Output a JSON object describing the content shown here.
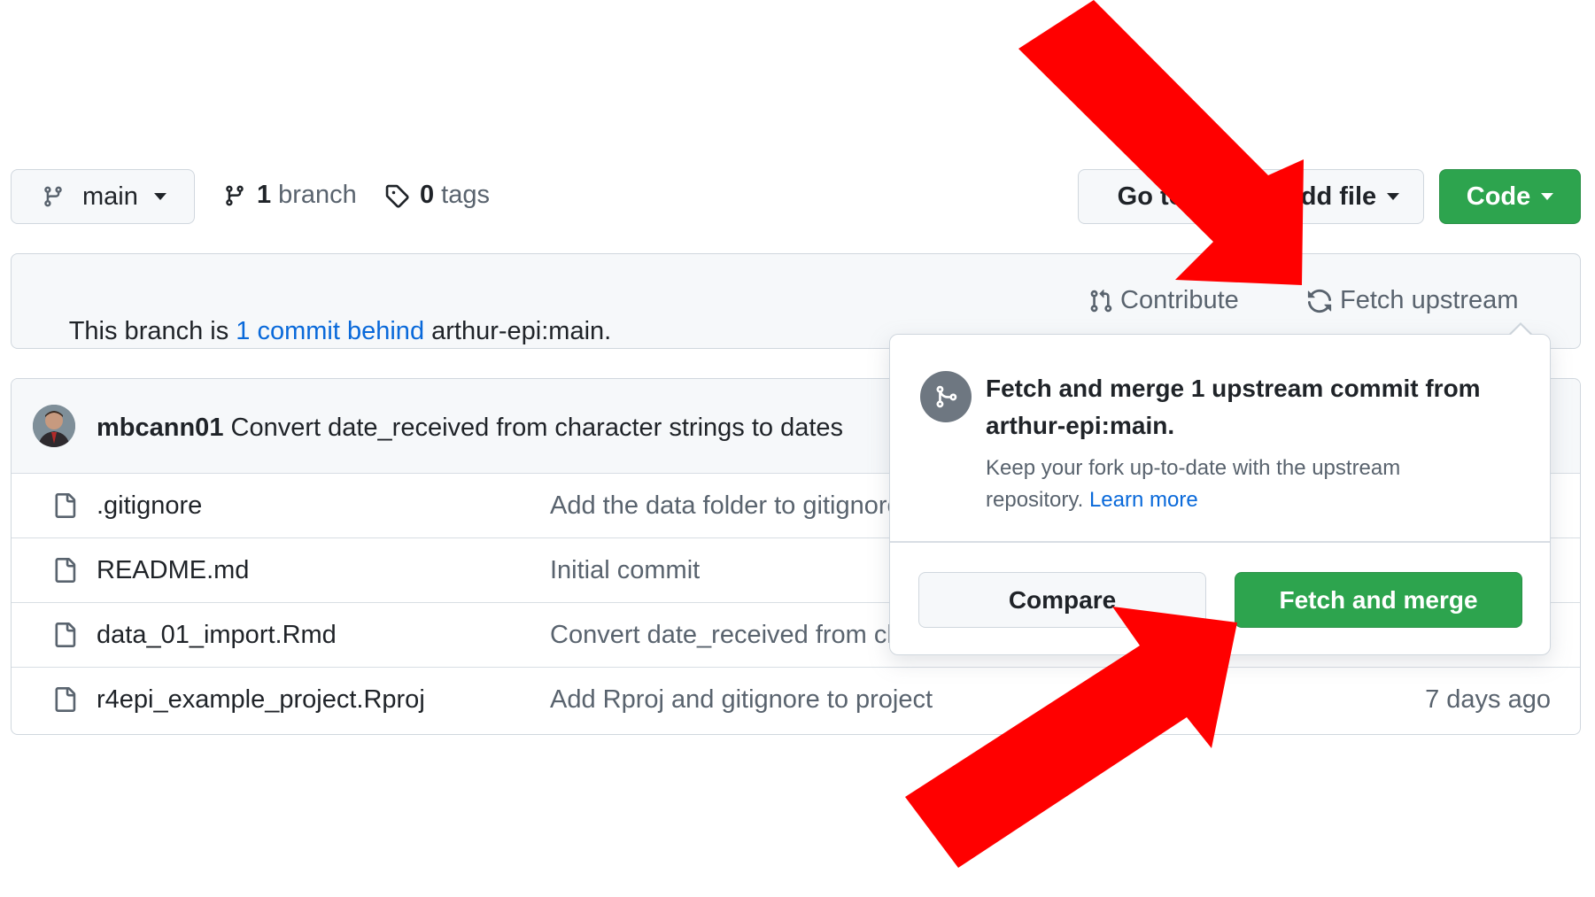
{
  "toolbar": {
    "branch_select_label": "main",
    "branches_count": "1",
    "branches_label": "branch",
    "tags_count": "0",
    "tags_label": "tags",
    "goto_file_label": "Go to file",
    "add_file_label": "Add file",
    "code_label": "Code"
  },
  "status_bar": {
    "text_prefix": "This branch is ",
    "behind_link": "1 commit behind",
    "text_suffix": " arthur-epi:main.",
    "contribute_label": "Contribute",
    "fetch_upstream_label": "Fetch upstream"
  },
  "latest_commit": {
    "author": "mbcann01",
    "message": "Convert date_received from character strings to dates"
  },
  "files": [
    {
      "name": ".gitignore",
      "message": "Add the data folder to gitignore",
      "date": ""
    },
    {
      "name": "README.md",
      "message": "Initial commit",
      "date": ""
    },
    {
      "name": "data_01_import.Rmd",
      "message": "Convert date_received from character strings to dates",
      "date": ""
    },
    {
      "name": "r4epi_example_project.Rproj",
      "message": "Add Rproj and gitignore to project",
      "date": "7 days ago"
    }
  ],
  "fetch_popup": {
    "title": "Fetch and merge 1 upstream commit from arthur-epi:main.",
    "description": "Keep your fork up-to-date with the upstream repository.",
    "learn_more": "Learn more",
    "compare_label": "Compare",
    "fetch_merge_label": "Fetch and merge"
  },
  "colors": {
    "green_button": "#2da44e",
    "link_blue": "#0969da",
    "annotation_arrow": "#ff0000"
  },
  "icons": [
    "git-branch-icon",
    "tag-icon",
    "git-pull-request-icon",
    "sync-icon",
    "file-icon",
    "git-merge-icon",
    "avatar"
  ]
}
